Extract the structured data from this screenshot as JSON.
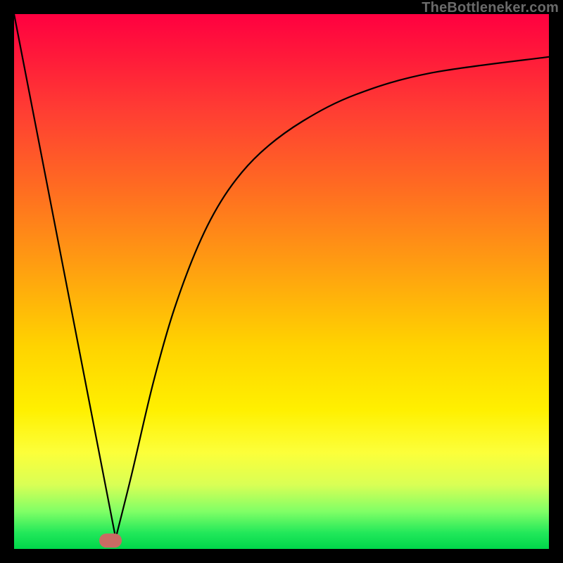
{
  "watermark": "TheBottleneker.com",
  "colors": {
    "frame": "#000000",
    "curve": "#000000",
    "marker": "#c96b63"
  },
  "chart_data": {
    "type": "line",
    "title": "",
    "xlabel": "",
    "ylabel": "",
    "xlim": [
      0,
      100
    ],
    "ylim": [
      0,
      100
    ],
    "grid": false,
    "legend": false,
    "series": [
      {
        "name": "left-branch",
        "x": [
          0,
          19
        ],
        "y": [
          100,
          2
        ],
        "style": "linear"
      },
      {
        "name": "right-branch",
        "x": [
          19,
          22,
          26,
          30,
          35,
          40,
          46,
          54,
          64,
          78,
          100
        ],
        "y": [
          2,
          14,
          31,
          45,
          58,
          67,
          74,
          80,
          85,
          89,
          92
        ],
        "style": "concave-increasing"
      }
    ],
    "gradient_stops": [
      {
        "pos": 0.0,
        "color": "#ff0040"
      },
      {
        "pos": 0.18,
        "color": "#ff3d33"
      },
      {
        "pos": 0.46,
        "color": "#ff9a12"
      },
      {
        "pos": 0.74,
        "color": "#fff000"
      },
      {
        "pos": 0.93,
        "color": "#80ff66"
      },
      {
        "pos": 1.0,
        "color": "#00d64a"
      }
    ],
    "marker": {
      "x": 18.0,
      "y": 1.6,
      "w_pct": 4.2,
      "h_pct": 2.6
    }
  }
}
